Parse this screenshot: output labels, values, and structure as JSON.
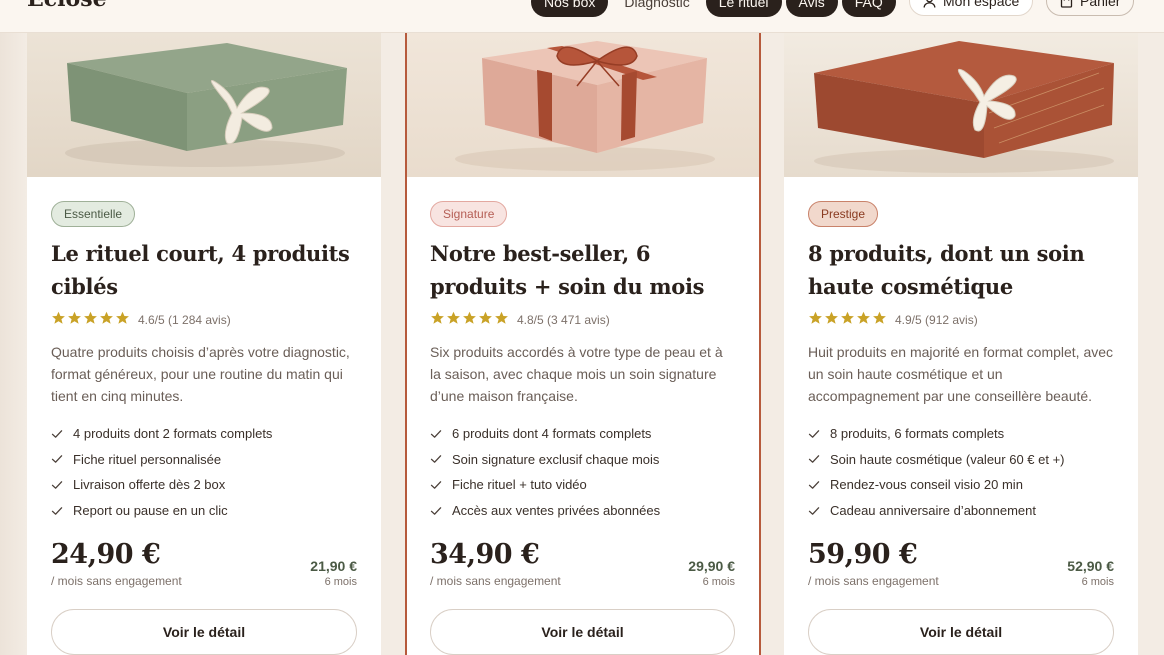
{
  "header": {
    "logo": "Éclose",
    "nav": [
      "Nos box",
      "Diagnostic",
      "Le rituel",
      "Avis",
      "FAQ"
    ],
    "account_label": "Mon espace",
    "cart_label": "Panier"
  },
  "cards": [
    {
      "badge": "Essentielle",
      "title": "Le rituel court, 4 produits ciblés",
      "rating": "4.6/5 (1 284 avis)",
      "stars": 5,
      "description": "Quatre produits choisis d’après votre diagnostic, format généreux, pour une routine du matin qui tient en cinq minutes.",
      "features": [
        "4 produits dont 2 formats complets",
        "Fiche rituel personnalisée",
        "Livraison offerte dès 2 box",
        "Report ou pause en un clic"
      ],
      "price": "24,90 €",
      "price_note": "/ mois sans engagement",
      "alt_price": "21,90 €",
      "alt_duration": "6 mois",
      "cta": "Voir le détail"
    },
    {
      "badge": "Signature",
      "title": "Notre best-seller, 6 produits + soin du mois",
      "rating": "4.8/5 (3 471 avis)",
      "stars": 5,
      "description": "Six produits accordés à votre type de peau et à la saison, avec chaque mois un soin signature d’une maison française.",
      "features": [
        "6 produits dont 4 formats complets",
        "Soin signature exclusif chaque mois",
        "Fiche rituel + tuto vidéo",
        "Accès aux ventes privées abonnées"
      ],
      "price": "34,90 €",
      "price_note": "/ mois sans engagement",
      "alt_price": "29,90 €",
      "alt_duration": "6 mois",
      "cta": "Voir le détail"
    },
    {
      "badge": "Prestige",
      "title": "8 produits, dont un soin haute cosmétique",
      "rating": "4.9/5 (912 avis)",
      "stars": 5,
      "description": "Huit produits en majorité en format complet, avec un soin haute cosmétique et un accompagnement par une conseillère beauté.",
      "features": [
        "8 produits, 6 formats complets",
        "Soin haute cosmétique (valeur 60 € et +)",
        "Rendez-vous conseil visio 20 min",
        "Cadeau anniversaire d’abonnement"
      ],
      "price": "59,90 €",
      "price_note": "/ mois sans engagement",
      "alt_price": "52,90 €",
      "alt_duration": "6 mois",
      "cta": "Voir le détail"
    }
  ],
  "colors": {
    "background": "#f3ece4",
    "accent": "#b65a3c",
    "star": "#c9a227",
    "dark": "#2a211c"
  }
}
